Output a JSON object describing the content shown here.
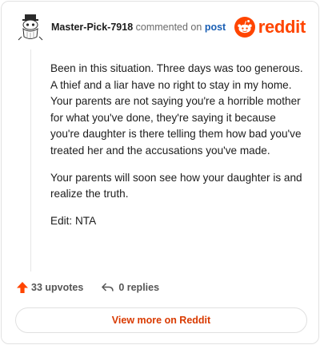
{
  "comment": {
    "username": "Master-Pick-7918",
    "action_text": "commented on",
    "target_link": "post",
    "paragraphs": [
      "Been in this situation. Three days was too generous. A thief and a liar have no right to stay in my home. Your parents are not saying you're a horrible mother for what you've done, they're saying it because you're daughter is there telling them how bad you've treated her and the accusations you've made.",
      "Your parents will soon see how your daughter is and realize the truth.",
      "Edit: NTA"
    ]
  },
  "brand": {
    "name": "reddit",
    "color": "#ff4500"
  },
  "stats": {
    "upvotes": "33 upvotes",
    "replies": "0 replies"
  },
  "cta": {
    "label": "View more on Reddit"
  },
  "icons": {
    "avatar": "snoo-avatar-icon",
    "logo": "reddit-logo-icon",
    "upvote": "upvote-arrow-icon",
    "reply": "reply-arrow-icon"
  },
  "colors": {
    "accent": "#ff4500",
    "link": "#1a5fb4",
    "cta_text": "#d93a00"
  }
}
